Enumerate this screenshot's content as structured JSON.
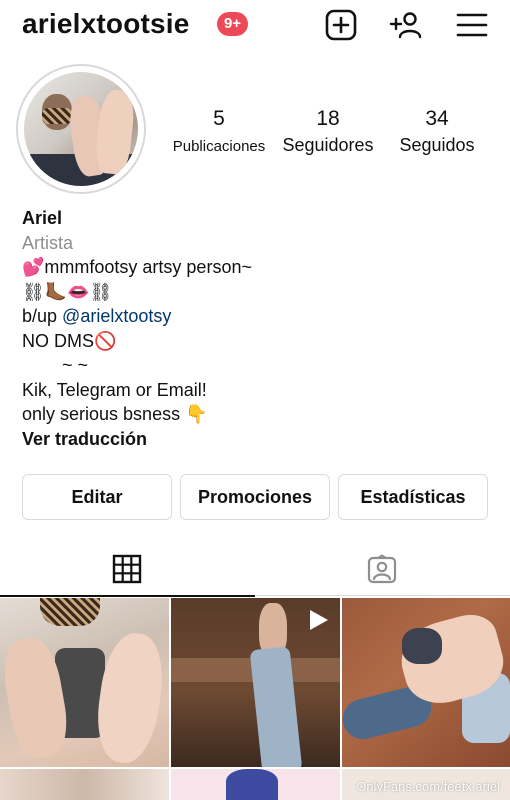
{
  "header": {
    "username": "arielxtootsie",
    "notification_badge": "9+",
    "badge_color": "#ed4956",
    "icons": [
      "new-post-icon",
      "add-person-icon",
      "menu-icon"
    ]
  },
  "profile": {
    "stats": [
      {
        "value": "5",
        "label": "Publicaciones"
      },
      {
        "value": "18",
        "label": "Seguidores"
      },
      {
        "value": "34",
        "label": "Seguidos"
      }
    ],
    "bio": {
      "name": "Ariel",
      "category": "Artista",
      "lines": [
        "💕mmmfootsy artsy person~",
        "⛓🦶🏾👄⛓",
        "b/up ",
        "NO DMS🚫",
        "        ~ ~",
        "Kik, Telegram or Email!",
        "only serious bsness 👇"
      ],
      "mention": "@arielxtootsy",
      "mention_color": "#00376b",
      "translate_label": "Ver traducción"
    }
  },
  "actions": {
    "edit_label": "Editar",
    "promotions_label": "Promociones",
    "stats_label": "Estadísticas"
  },
  "tabs": {
    "items": [
      "grid-icon",
      "tagged-icon"
    ],
    "active": "grid-icon"
  },
  "grid": {
    "posts": [
      {
        "type": "photo"
      },
      {
        "type": "video"
      },
      {
        "type": "photo"
      },
      {
        "type": "photo"
      },
      {
        "type": "photo"
      },
      {
        "type": "photo"
      }
    ],
    "watermark": "OnlyFans.com/feetx.ariel"
  }
}
